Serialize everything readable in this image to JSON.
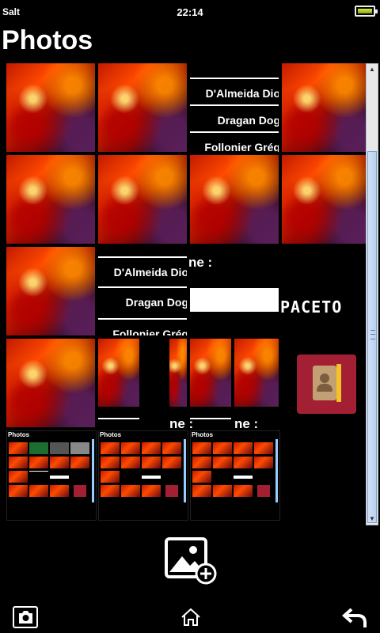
{
  "status": {
    "carrier": "Salt",
    "time": "22:14",
    "battery_icon": "battery-icon"
  },
  "page": {
    "title": "Photos"
  },
  "contacts_list": [
    "D'Almeida Dio",
    "Dragan Dog",
    "Follonier Grég"
  ],
  "fragments": {
    "name_label": "ne :",
    "spaceton": "PACETO"
  },
  "mini_screens": {
    "title": "Photos",
    "spaceton": "PACETON"
  },
  "icons": {
    "add_photo": "add-photo-icon",
    "camera": "camera-icon",
    "home": "home-icon",
    "back": "back-arrow-icon",
    "address_book": "address-book-icon"
  },
  "colors": {
    "background": "#000000",
    "address_book": "#a31f33",
    "scrollbar_thumb": "#c4d9f4"
  }
}
